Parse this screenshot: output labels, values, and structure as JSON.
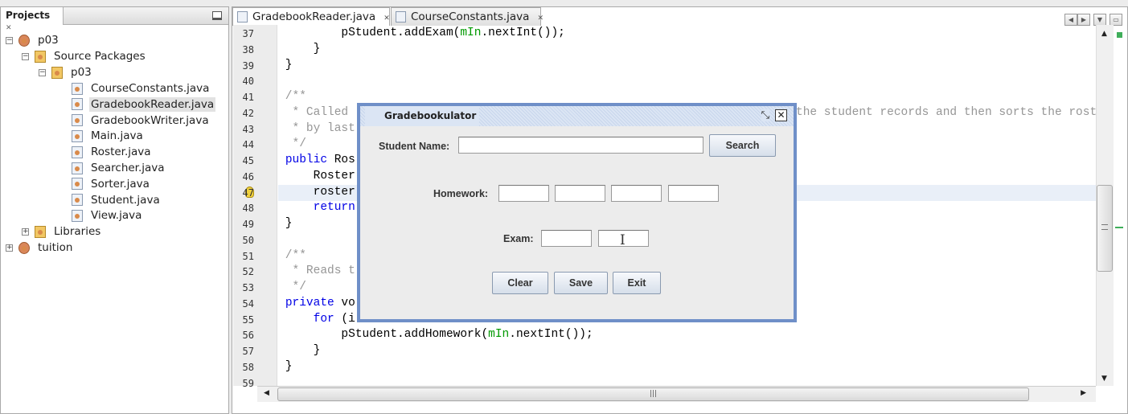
{
  "projects_panel": {
    "title": "Projects",
    "tree": [
      {
        "label": "p03",
        "level": 0
      },
      {
        "label": "Source Packages",
        "level": 1
      },
      {
        "label": "p03",
        "level": 2
      },
      {
        "label": "CourseConstants.java",
        "level": 3
      },
      {
        "label": "GradebookReader.java",
        "level": 3,
        "selected": true
      },
      {
        "label": "GradebookWriter.java",
        "level": 3
      },
      {
        "label": "Main.java",
        "level": 3
      },
      {
        "label": "Roster.java",
        "level": 3
      },
      {
        "label": "Searcher.java",
        "level": 3
      },
      {
        "label": "Sorter.java",
        "level": 3
      },
      {
        "label": "Student.java",
        "level": 3
      },
      {
        "label": "View.java",
        "level": 3
      },
      {
        "label": "Libraries",
        "level": 1
      },
      {
        "label": "tuition",
        "level": 0
      }
    ]
  },
  "editor": {
    "tabs": [
      {
        "label": "GradebookReader.java",
        "active": true
      },
      {
        "label": "CourseConstants.java",
        "active": false
      }
    ],
    "lines": [
      {
        "n": "37",
        "t": "            pStudent.addExam(mIn.nextInt());"
      },
      {
        "n": "38",
        "t": "        }"
      },
      {
        "n": "39",
        "t": "    }"
      },
      {
        "n": "40",
        "t": ""
      },
      {
        "n": "41",
        "t": "    /**"
      },
      {
        "n": "42",
        "t": "     * Called"
      },
      {
        "n": "43",
        "t": "     * by last"
      },
      {
        "n": "44",
        "t": "     */"
      },
      {
        "n": "45",
        "t": "    public Ros"
      },
      {
        "n": "46",
        "t": "        Roster"
      },
      {
        "n": "47",
        "t": "        roster"
      },
      {
        "n": "48",
        "t": "        return"
      },
      {
        "n": "49",
        "t": "    }"
      },
      {
        "n": "50",
        "t": ""
      },
      {
        "n": "51",
        "t": "    /**"
      },
      {
        "n": "52",
        "t": "     * Reads t"
      },
      {
        "n": "53",
        "t": "     */"
      },
      {
        "n": "54",
        "t": "    private vo"
      },
      {
        "n": "55",
        "t": "        for (i"
      },
      {
        "n": "56",
        "t": "            pStudent.addHomework(mIn.nextInt());"
      },
      {
        "n": "57",
        "t": "        }"
      },
      {
        "n": "58",
        "t": "    }"
      },
      {
        "n": "59",
        "t": ""
      }
    ],
    "line42_tail": "the student records and then sorts the rost"
  },
  "dialog": {
    "title": "Gradebookulator",
    "student_name_label": "Student Name:",
    "student_name_value": "",
    "search_label": "Search",
    "homework_label": "Homework:",
    "homework_values": [
      "",
      "",
      "",
      ""
    ],
    "exam_label": "Exam:",
    "exam_values": [
      "",
      ""
    ],
    "clear_label": "Clear",
    "save_label": "Save",
    "exit_label": "Exit"
  }
}
